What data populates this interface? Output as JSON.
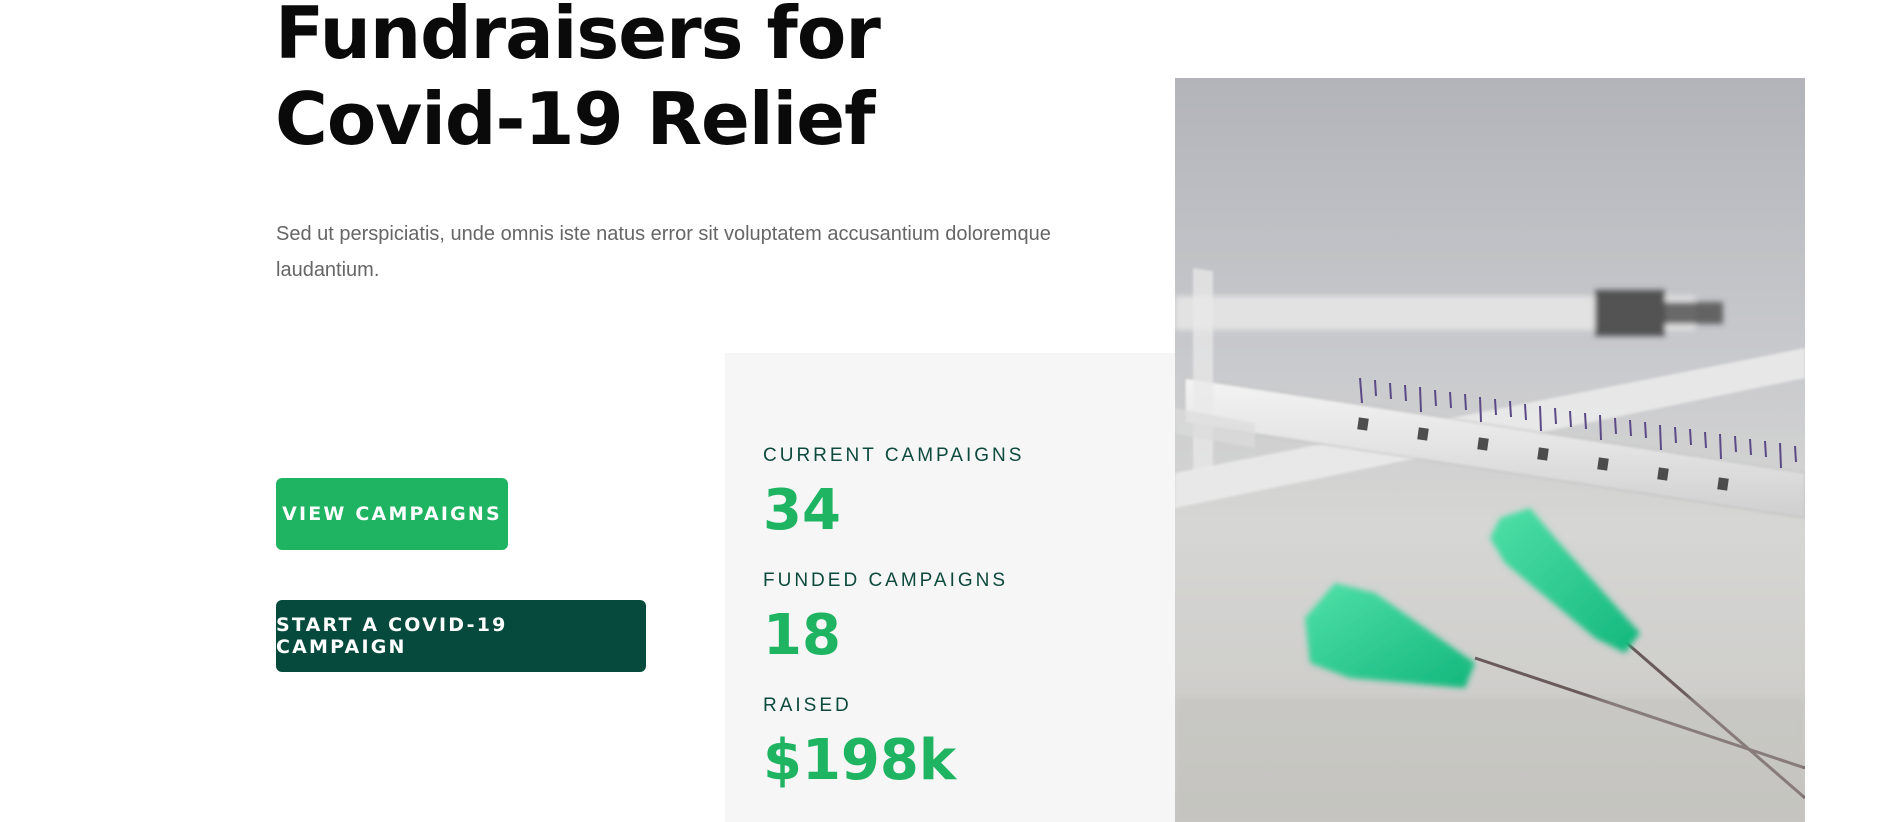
{
  "hero": {
    "title_line1": "Fundraisers for",
    "title_line2": "Covid-19 Relief",
    "description": "Sed ut perspiciatis, unde omnis iste natus error sit voluptatem accusantium doloremque laudantium."
  },
  "buttons": {
    "view_campaigns": "VIEW CAMPAIGNS",
    "start_campaign": "START A COVID-19 CAMPAIGN"
  },
  "stats": {
    "current_label": "CURRENT CAMPAIGNS",
    "current_value": "34",
    "funded_label": "FUNDED CAMPAIGNS",
    "funded_value": "18",
    "raised_label": "RAISED",
    "raised_value": "$198k"
  },
  "colors": {
    "accent_green": "#1eb462",
    "dark_green": "#054a3c",
    "stats_label": "#0d4a3d",
    "panel_bg": "#f6f6f6"
  }
}
